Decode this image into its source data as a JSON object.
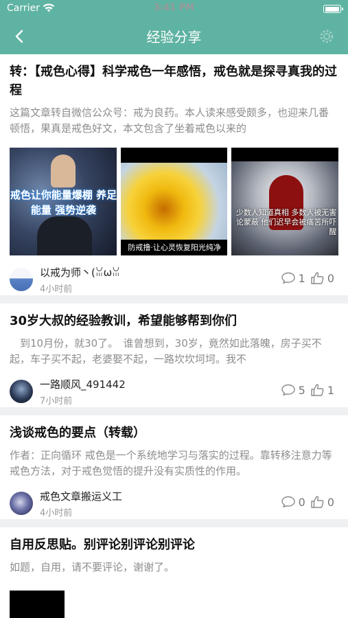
{
  "status_bar": {
    "carrier": "Carrier",
    "time": "3:41 PM"
  },
  "nav": {
    "title": "经验分享"
  },
  "posts": [
    {
      "title": "转：【戒色心得】科学戒色一年感悟，戒色就是探寻真我的过程",
      "excerpt": "这篇文章转自微信公众号：戒为良药。本人读来感受颇多，也迎来几番顿悟，果真是戒色好文，本文包含了坐着戒色以来的",
      "images": [
        {
          "caption": "戒色让你能量爆棚 养足能量 强势逆袭"
        },
        {
          "caption": "防戒撸·让心灵恢复阳光纯净"
        },
        {
          "caption": "少数人知道真相 多数人被无害论蒙蔽 他们迟早会被痛苦所吓醒"
        }
      ],
      "author": "以戒为师丶(ꈍωꈍ",
      "time": "4小时前",
      "comments": "1",
      "likes": "0"
    },
    {
      "title": "30岁大叔的经验教训，希望能够帮到你们",
      "excerpt": "　到10月份，就30了。　谁曾想到，30岁，竟然如此落魄，房子买不起，车子买不起，老婆娶不起，一路坎坎坷坷。我不",
      "author": "一路顺风_491442",
      "time": "7小时前",
      "comments": "5",
      "likes": "1"
    },
    {
      "title": "浅谈戒色的要点（转载）",
      "excerpt": "作者：正向循环 戒色是一个系统地学习与落实的过程。靠转移注意力等戒色方法，对于戒色觉悟的提升没有实质性的作用。",
      "author": "戒色文章搬运义工",
      "time": "4小时前",
      "comments": "0",
      "likes": "0"
    },
    {
      "title": "自用反思贴。别评论别评论别评论",
      "excerpt": "如题，自用，请不要评论，谢谢了。"
    }
  ],
  "icons": {
    "back": "chevron-left-icon",
    "settings": "gear-icon",
    "comment": "speech-bubble-icon",
    "like": "thumbs-up-icon",
    "wifi": "wifi-icon",
    "battery": "battery-icon"
  },
  "colors": {
    "header": "#5fb3a2",
    "background": "#eef0f2"
  }
}
